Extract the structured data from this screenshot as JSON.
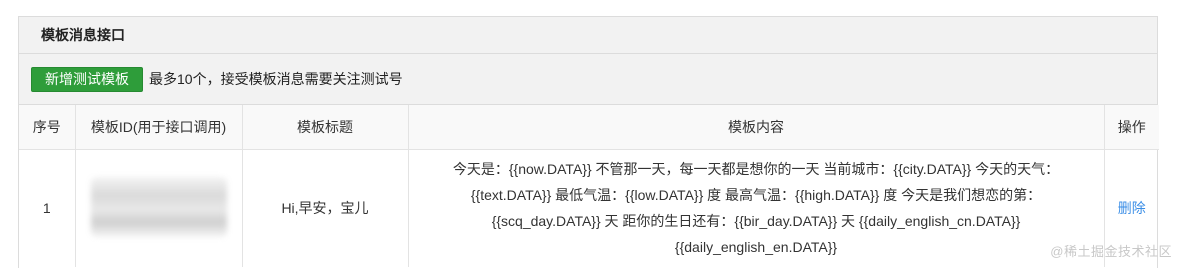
{
  "panel": {
    "title": "模板消息接口"
  },
  "toolbar": {
    "add_button_label": "新增测试模板",
    "note": "最多10个，接受模板消息需要关注测试号"
  },
  "table": {
    "headers": {
      "index": "序号",
      "template_id": "模板ID(用于接口调用)",
      "template_title": "模板标题",
      "template_content": "模板内容",
      "action": "操作"
    },
    "rows": [
      {
        "index": "1",
        "title": "Hi,早安，宝儿",
        "content": "今天是：{{now.DATA}} 不管那一天，每一天都是想你的一天 当前城市：{{city.DATA}} 今天的天气：{{text.DATA}} 最低气温：{{low.DATA}} 度 最高气温：{{high.DATA}} 度 今天是我们想恋的第：{{scq_day.DATA}} 天 距你的生日还有：{{bir_day.DATA}} 天 {{daily_english_cn.DATA}} {{daily_english_en.DATA}}",
        "action": "删除"
      }
    ]
  },
  "watermark": "@稀土掘金技术社区"
}
